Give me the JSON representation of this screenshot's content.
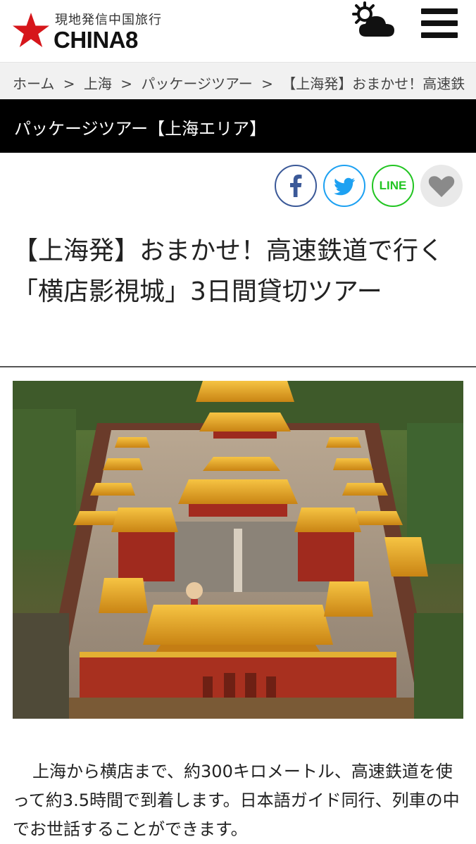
{
  "header": {
    "logo_sub": "現地発信中国旅行",
    "logo_name": "CHINA8",
    "brand_color": "#d6161b",
    "weather_icon": "partly-cloudy-icon",
    "menu_icon": "hamburger-menu-icon"
  },
  "breadcrumb": {
    "items": [
      "ホーム",
      "上海",
      "パッケージツアー",
      "【上海発】おまかせ！高速鉄"
    ],
    "separator": ">"
  },
  "category": {
    "title": "パッケージツアー【上海エリア】"
  },
  "share": {
    "facebook_color": "#3b5998",
    "twitter_color": "#1da1f2",
    "line_label": "LINE",
    "line_color": "#22c522",
    "favorite_icon": "heart-icon"
  },
  "article": {
    "title": "【上海発】おまかせ！高速鉄道で行く「横店影視城」3日間貸切ツアー",
    "body": "上海から横店まで、約300キロメートル、高速鉄道を使って約3.5時間で到着します。日本語ガイド同行、列車の中でお世話することができます。"
  }
}
